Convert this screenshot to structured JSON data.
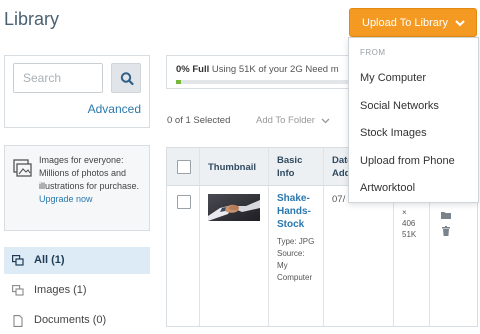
{
  "page": {
    "title": "Library"
  },
  "search": {
    "placeholder": "Search",
    "advanced_label": "Advanced"
  },
  "promo": {
    "text": "Images for everyone: Millions of photos and illustrations for purchase.",
    "link_label": "Upgrade now"
  },
  "sidebar": {
    "items": [
      {
        "label": "All (1)",
        "icon": "all-items-icon",
        "active": true
      },
      {
        "label": "Images (1)",
        "icon": "images-icon",
        "active": false
      },
      {
        "label": "Documents (0)",
        "icon": "documents-icon",
        "active": false
      }
    ]
  },
  "storage": {
    "percent_label": "0% Full",
    "usage_text": "Using 51K of your 2G",
    "truncated_text": "Need m",
    "used_fraction": 0.03
  },
  "toolbar": {
    "selected_label": "0 of 1 Selected",
    "add_folder_label": "Add To Folder"
  },
  "table": {
    "headers": {
      "thumbnail": "Thumbnail",
      "basic_info_line1": "Basic",
      "basic_info_line2": "Info",
      "date_line1": "Date",
      "date_line2": "Add"
    },
    "rows": [
      {
        "title_lines": [
          "Shake-",
          "Hands-",
          "Stock"
        ],
        "meta_lines": [
          "Type: JPG",
          "Source:",
          "My",
          "Computer"
        ],
        "date": "07/",
        "dims": [
          "×",
          "406",
          "51K"
        ]
      }
    ]
  },
  "upload": {
    "button_label": "Upload To Library",
    "menu_header": "FROM",
    "menu_items": [
      "My Computer",
      "Social Networks",
      "Stock Images",
      "Upload from Phone",
      "Artworktool"
    ]
  },
  "colors": {
    "accent": "#f49a22",
    "link": "#2a78ad",
    "active_nav_bg": "#dcebf6",
    "progress": "#78b838"
  }
}
